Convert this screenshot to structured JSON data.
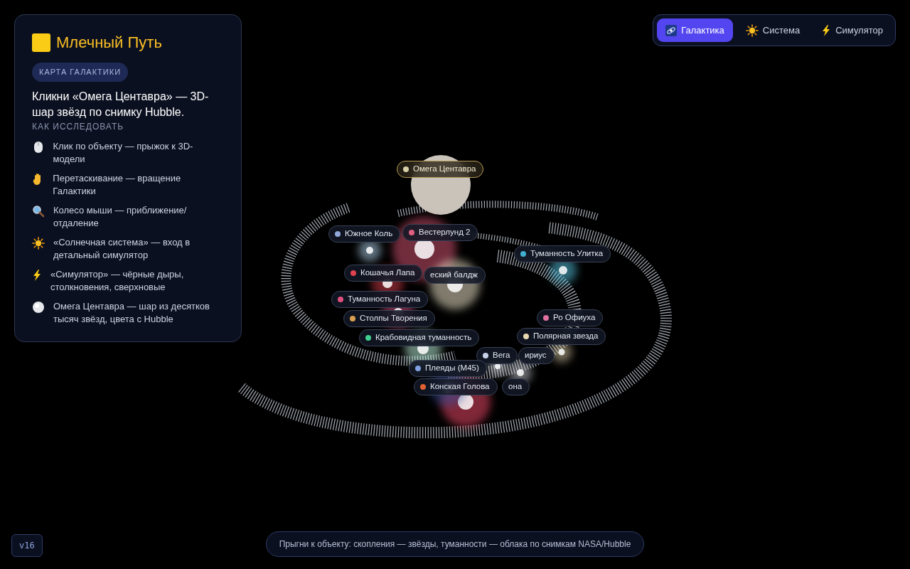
{
  "info_panel": {
    "title": "Млечный Путь",
    "badge": "КАРТА ГАЛАКТИКИ",
    "hint": "Кликни «Омега Центавра» — 3D-шар звёзд по снимку Hubble.",
    "section_title": "КАК ИССЛЕДОВАТЬ",
    "items": [
      {
        "kind": "mouse",
        "text": "Клик по объекту — прыжок к 3D-модели"
      },
      {
        "kind": "hand",
        "text": "Перетаскивание — вращение Галактики"
      },
      {
        "kind": "search",
        "text": "Колесо мыши — приближение/отдаление"
      },
      {
        "kind": "sun",
        "text": "«Солнечная система» — вход в детальный симулятор"
      },
      {
        "kind": "bolt",
        "text": "«Симулятор» — чёрные дыры, столкновения, сверхновые"
      },
      {
        "kind": "sphere",
        "text": "Омега Центавра — шар из десятков тысяч звёзд, цвета с Hubble"
      }
    ]
  },
  "tabs": [
    {
      "label": "Галактика",
      "kind": "galaxy",
      "selected": true
    },
    {
      "label": "Система",
      "kind": "sun",
      "selected": false
    },
    {
      "label": "Симулятор",
      "kind": "bolt",
      "selected": false
    }
  ],
  "map_labels": [
    {
      "text": "Омега Центавра",
      "color": "#d9cfa8",
      "featured": true
    },
    {
      "text": "Южное Коль",
      "color": "#8fa8d8",
      "featured": false
    },
    {
      "text": "Вестерлунд 2",
      "color": "#e06080",
      "featured": false
    },
    {
      "text": "Туманность Улитка",
      "color": "#40b0d0",
      "featured": false
    },
    {
      "text": "еский балдж",
      "featured": false
    },
    {
      "text": "Кошачья Лапа",
      "color": "#e04050",
      "featured": false
    },
    {
      "text": "Туманность Лагуна",
      "color": "#e05080",
      "featured": false
    },
    {
      "text": "Столпы Творения",
      "color": "#d8a050",
      "featured": false
    },
    {
      "text": "Крабовидная туманность",
      "color": "#40d090",
      "featured": false
    },
    {
      "text": "Ро Офиуха",
      "color": "#e070a0",
      "featured": false
    },
    {
      "text": "Полярная звезда",
      "color": "#e8d8b0",
      "featured": false
    },
    {
      "text": "ириус",
      "featured": false
    },
    {
      "text": "Вега",
      "color": "#c8d0e8",
      "featured": false
    },
    {
      "text": "она",
      "featured": false
    },
    {
      "text": "Плеяды (М45)",
      "color": "#80a0e0",
      "featured": false
    },
    {
      "text": "Конская Голова",
      "color": "#e06030",
      "featured": false
    }
  ],
  "version": "v16",
  "footer": "Прыгни к объекту: скопления — звёзды, туманности — облака по снимкам NASA/Hubble"
}
